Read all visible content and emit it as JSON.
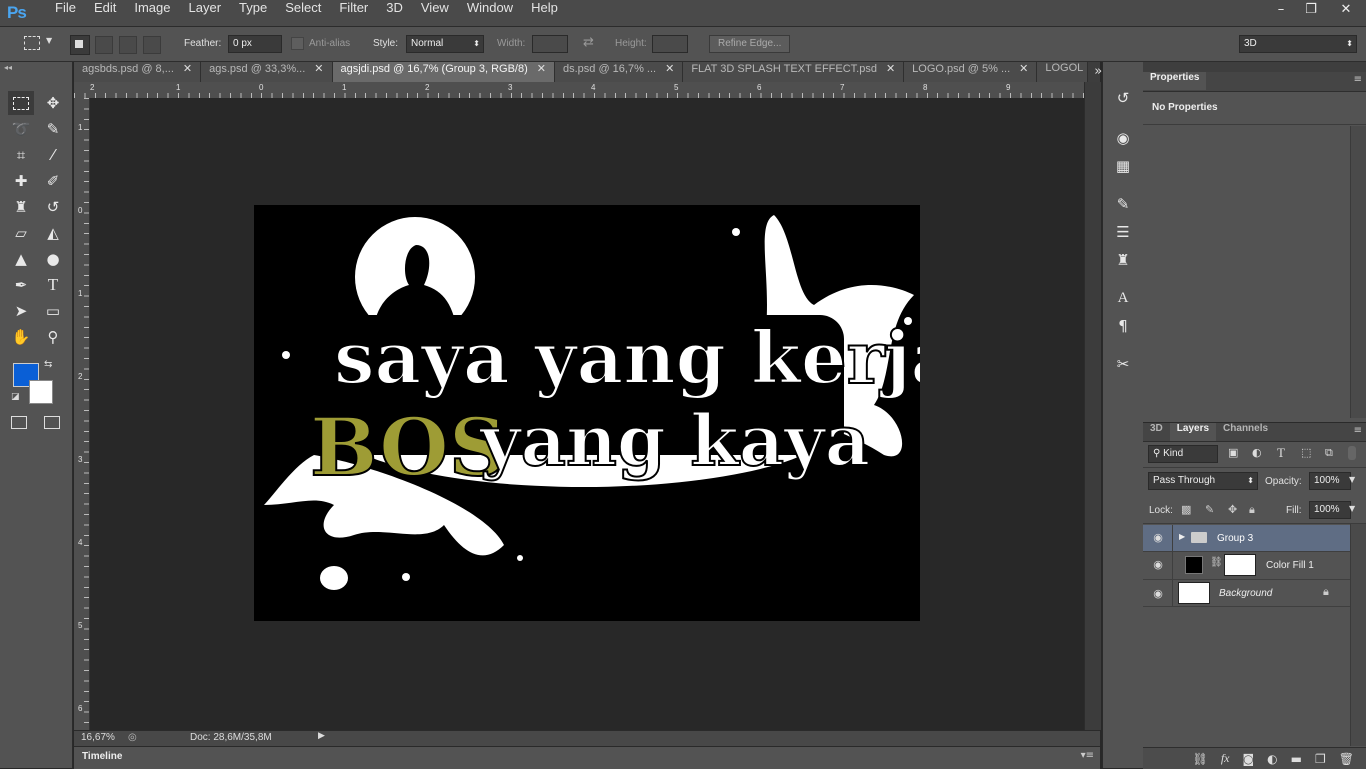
{
  "app": {
    "logo": "Ps"
  },
  "menu": [
    "File",
    "Edit",
    "Image",
    "Layer",
    "Type",
    "Select",
    "Filter",
    "3D",
    "View",
    "Window",
    "Help"
  ],
  "window_controls": {
    "minimize": "–",
    "restore": "❐",
    "close": "✕"
  },
  "options": {
    "feather_label": "Feather:",
    "feather_value": "0 px",
    "antialias_label": "Anti-alias",
    "style_label": "Style:",
    "style_value": "Normal",
    "width_label": "Width:",
    "height_label": "Height:",
    "refine_edge": "Refine Edge...",
    "workspace": "3D"
  },
  "tabs": [
    {
      "label": "agsbds.psd @ 8,..."
    },
    {
      "label": "ags.psd @ 33,3%..."
    },
    {
      "label": "agsjdi.psd @ 16,7% (Group 3, RGB/8)",
      "active": true
    },
    {
      "label": "ds.psd @ 16,7% ..."
    },
    {
      "label": "FLAT 3D SPLASH TEXT EFFECT.psd"
    },
    {
      "label": "LOGO.psd @ 5% ..."
    },
    {
      "label": "LOGOL"
    }
  ],
  "tab_close": "✕",
  "tab_overflow": "»",
  "ruler_h": [
    "2",
    "1",
    "0",
    "1",
    "2",
    "3",
    "4",
    "5",
    "6",
    "7",
    "8",
    "9"
  ],
  "ruler_v": [
    "1",
    "0",
    "1",
    "2",
    "3",
    "4",
    "5",
    "6"
  ],
  "artwork": {
    "line1": "saya yang kerja",
    "line2_accent": "BOS",
    "line2_rest": "yang kaya",
    "accent_color": "#9e9c35"
  },
  "status": {
    "zoom": "16,67%",
    "doc": "Doc: 28,6M/35,8M"
  },
  "timeline": {
    "label": "Timeline"
  },
  "colors": {
    "foreground": "#0a5fd6",
    "background": "#ffffff"
  },
  "properties": {
    "tab": "Properties",
    "empty": "No Properties"
  },
  "layers_panel": {
    "tabs": [
      "3D",
      "Layers",
      "Channels"
    ],
    "kind_label": "Kind",
    "blend_mode": "Pass Through",
    "opacity_label": "Opacity:",
    "opacity_value": "100%",
    "lock_label": "Lock:",
    "fill_label": "Fill:",
    "fill_value": "100%",
    "layers": [
      {
        "name": "Group 3"
      },
      {
        "name": "Color Fill 1"
      },
      {
        "name": "Background"
      }
    ],
    "footer_icons": [
      "link-icon",
      "fx-icon",
      "mask-icon",
      "adjustment-icon",
      "folder-icon",
      "new-layer-icon",
      "trash-icon"
    ]
  }
}
